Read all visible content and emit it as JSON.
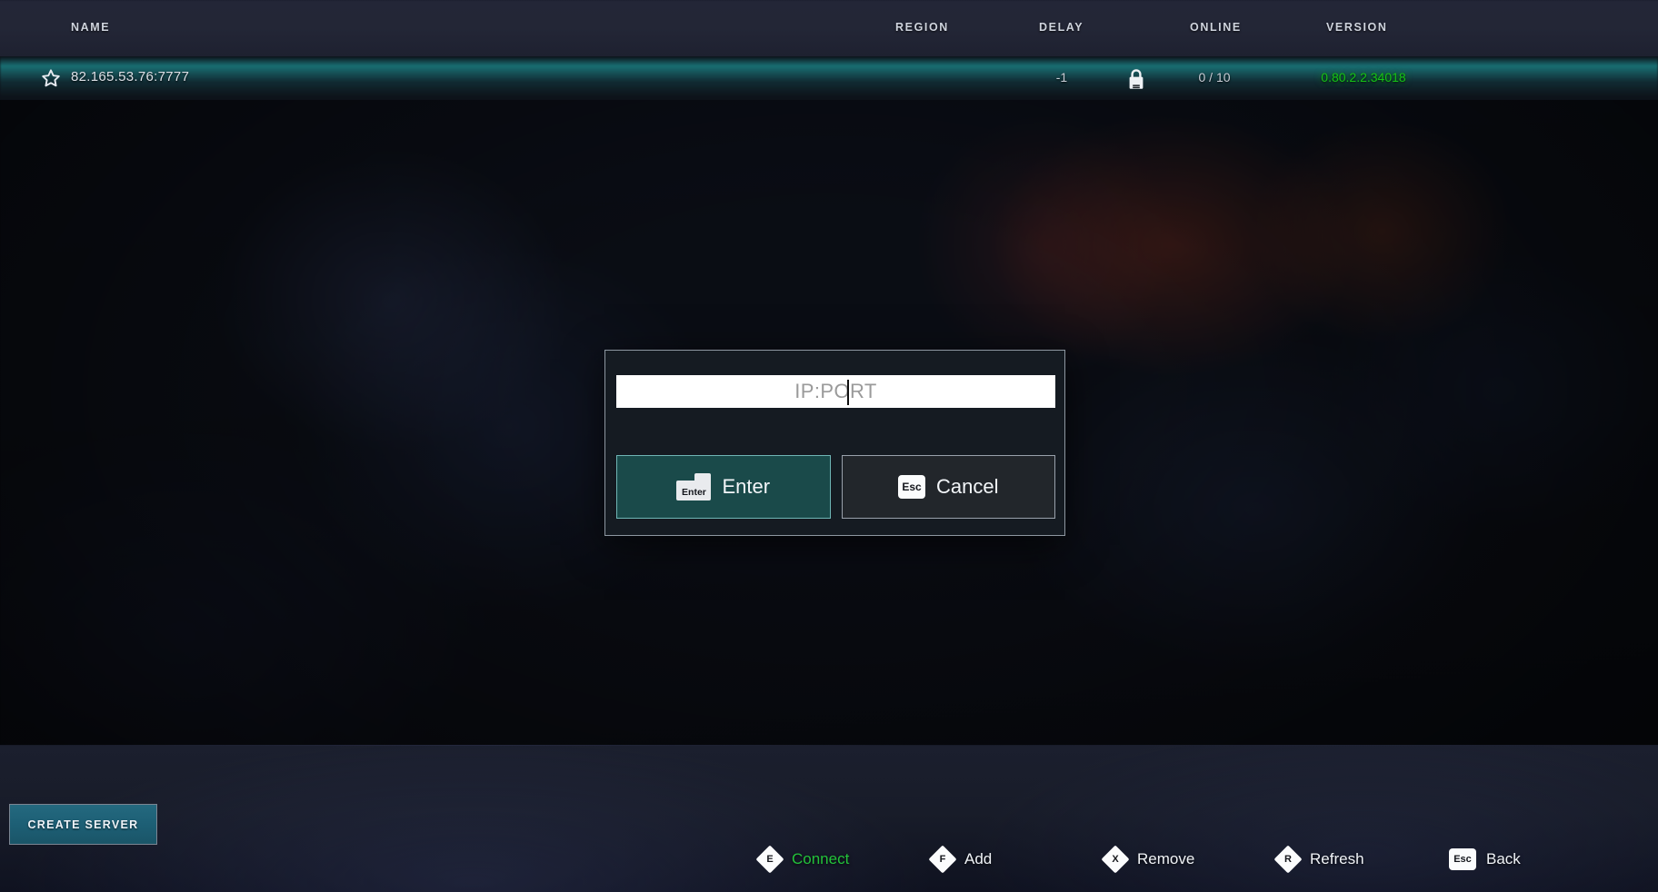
{
  "table": {
    "columns": [
      {
        "key": "name",
        "label": "NAME"
      },
      {
        "key": "region",
        "label": "REGION"
      },
      {
        "key": "delay",
        "label": "DELAY"
      },
      {
        "key": "online",
        "label": "ONLINE"
      },
      {
        "key": "version",
        "label": "VERSION"
      }
    ],
    "rows": [
      {
        "favorite_icon": "star-icon",
        "name": "82.165.53.76:7777",
        "region": "",
        "delay": "-1",
        "locked_icon": "lock-icon",
        "online": "0 / 10",
        "version": "0.80.2.2.34018",
        "selected": true
      }
    ]
  },
  "footer": {
    "create_server_label": "CREATE SERVER",
    "hints": [
      {
        "key": "E",
        "badge": "diamond",
        "label": "Connect",
        "color": "#23c23a"
      },
      {
        "key": "F",
        "badge": "diamond",
        "label": "Add",
        "color": "#f0f3f7"
      },
      {
        "key": "X",
        "badge": "diamond",
        "label": "Remove",
        "color": "#f0f3f7"
      },
      {
        "key": "R",
        "badge": "diamond",
        "label": "Refresh",
        "color": "#f0f3f7"
      },
      {
        "key": "Esc",
        "badge": "square",
        "label": "Back",
        "color": "#f0f3f7"
      }
    ]
  },
  "dialog": {
    "input": {
      "value": "",
      "placeholder": "IP:PORT",
      "caret_after_chars": 4
    },
    "confirm": {
      "key": "Enter",
      "label": "Enter"
    },
    "cancel": {
      "key": "Esc",
      "label": "Cancel"
    }
  },
  "colors": {
    "accent_teal": "#18b8b8",
    "row_selected_glow": "#18b8b8",
    "version_green": "#16c316",
    "connect_green": "#23c23a",
    "create_server_blue": "#1d5f75",
    "dialog_bg": "#151b22",
    "dialog_border": "#8e97a1",
    "confirm_fill": "#1a4a4a",
    "confirm_border": "#6fb6b6"
  }
}
